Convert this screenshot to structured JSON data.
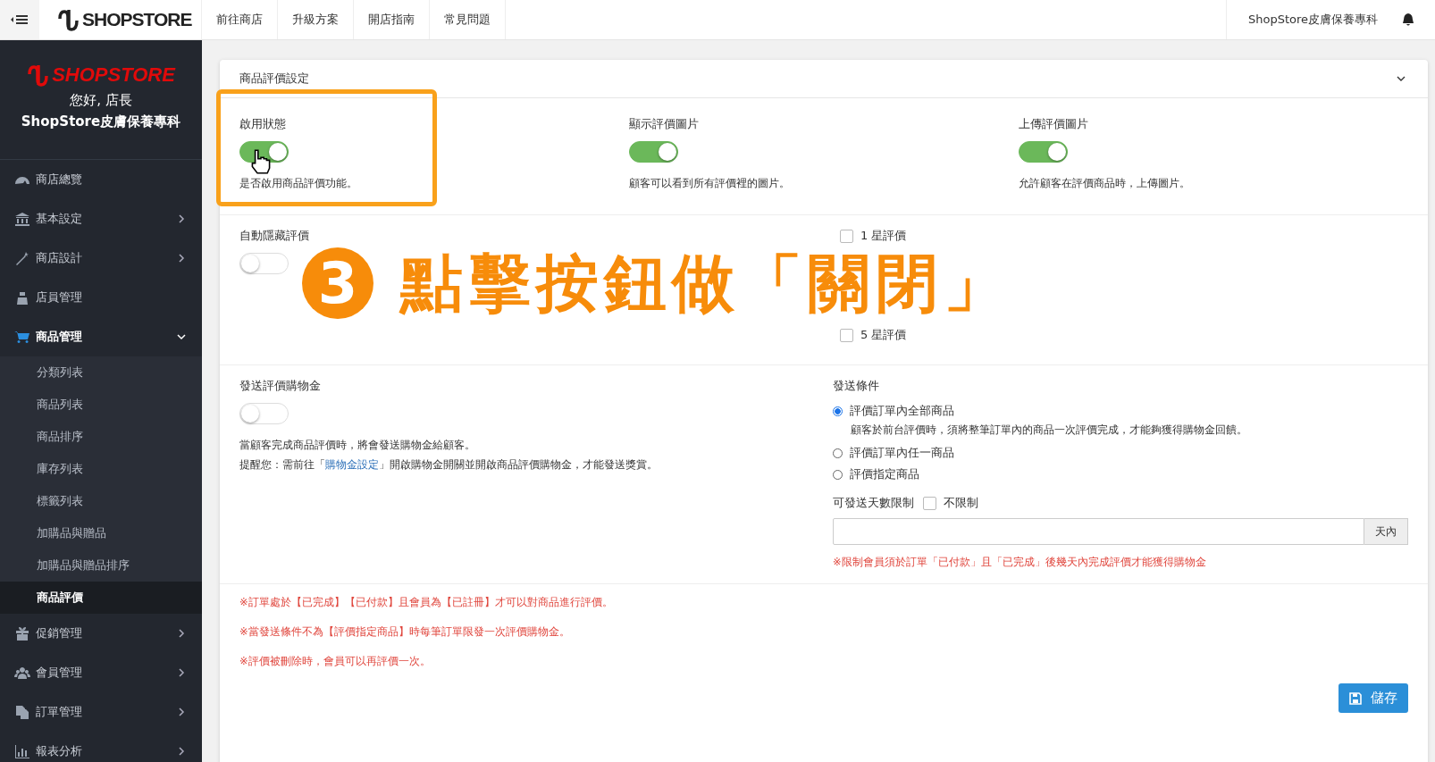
{
  "topbar": {
    "logo": "SHOPSTORE",
    "nav": [
      "前往商店",
      "升級方案",
      "開店指南",
      "常見問題"
    ],
    "store_name": "ShopStore皮膚保養專科"
  },
  "sidebar": {
    "logo": "SHOPSTORE",
    "greeting": "您好, 店長",
    "store_name": "ShopStore皮膚保養專科",
    "items": [
      {
        "label": "商店總覽",
        "expandable": false,
        "selected": false
      },
      {
        "label": "基本設定",
        "expandable": true,
        "expanded": false,
        "selected": false
      },
      {
        "label": "商店設計",
        "expandable": true,
        "expanded": false,
        "selected": false
      },
      {
        "label": "店員管理",
        "expandable": false,
        "selected": false
      },
      {
        "label": "商品管理",
        "expandable": true,
        "expanded": true,
        "selected": true,
        "children": [
          {
            "label": "分類列表",
            "selected": false
          },
          {
            "label": "商品列表",
            "selected": false
          },
          {
            "label": "商品排序",
            "selected": false
          },
          {
            "label": "庫存列表",
            "selected": false
          },
          {
            "label": "標籤列表",
            "selected": false
          },
          {
            "label": "加購品與贈品",
            "selected": false
          },
          {
            "label": "加購品與贈品排序",
            "selected": false
          },
          {
            "label": "商品評價",
            "selected": true
          }
        ]
      },
      {
        "label": "促銷管理",
        "expandable": true,
        "expanded": false,
        "selected": false
      },
      {
        "label": "會員管理",
        "expandable": true,
        "expanded": false,
        "selected": false
      },
      {
        "label": "訂單管理",
        "expandable": true,
        "expanded": false,
        "selected": false
      },
      {
        "label": "報表分析",
        "expandable": true,
        "expanded": false,
        "selected": false
      }
    ]
  },
  "panel": {
    "title": "商品評價設定",
    "toggles": [
      {
        "label": "啟用狀態",
        "on": true,
        "description": "是否啟用商品評價功能。"
      },
      {
        "label": "顯示評價圖片",
        "on": true,
        "description": "顧客可以看到所有評價裡的圖片。"
      },
      {
        "label": "上傳評價圖片",
        "on": true,
        "description": "允許顧客在評價商品時，上傳圖片。"
      }
    ],
    "auto_hide": {
      "label": "自動隱藏評價",
      "on": false,
      "stars": [
        {
          "label": "1 星評價",
          "checked": false
        },
        {
          "label": "5 星評價",
          "checked": false
        }
      ]
    },
    "reward": {
      "label": "發送評價購物金",
      "on": false,
      "description": "當顧客完成商品評價時，將會發送購物金給顧客。",
      "reminder_before": "提醒您：需前往「",
      "reminder_link": "購物金設定",
      "reminder_after": "」開啟購物金開關並開啟商品評價購物金，才能發送獎賞。"
    },
    "conditions": {
      "label": "發送條件",
      "options": [
        {
          "label": "評價訂單內全部商品",
          "selected": true,
          "hint": "顧客於前台評價時，須將整筆訂單內的商品一次評價完成，才能夠獲得購物金回饋。"
        },
        {
          "label": "評價訂單內任一商品",
          "selected": false
        },
        {
          "label": "評價指定商品",
          "selected": false
        }
      ],
      "days_label": "可發送天數限制",
      "unlimited": {
        "label": "不限制",
        "checked": false
      },
      "days_addon": "天內",
      "warning": "※限制會員須於訂單「已付款」且「已完成」後幾天內完成評價才能獲得購物金"
    },
    "notes": [
      "※訂單處於【已完成】【已付款】且會員為【已註冊】才可以對商品進行評價。",
      "※當發送條件不為【評價指定商品】時每筆訂單限發一次評價購物金。",
      "※評價被刪除時，會員可以再評價一次。"
    ],
    "save": "儲存"
  },
  "annotation": {
    "number": "3",
    "text": "點擊按鈕做「關閉」"
  }
}
